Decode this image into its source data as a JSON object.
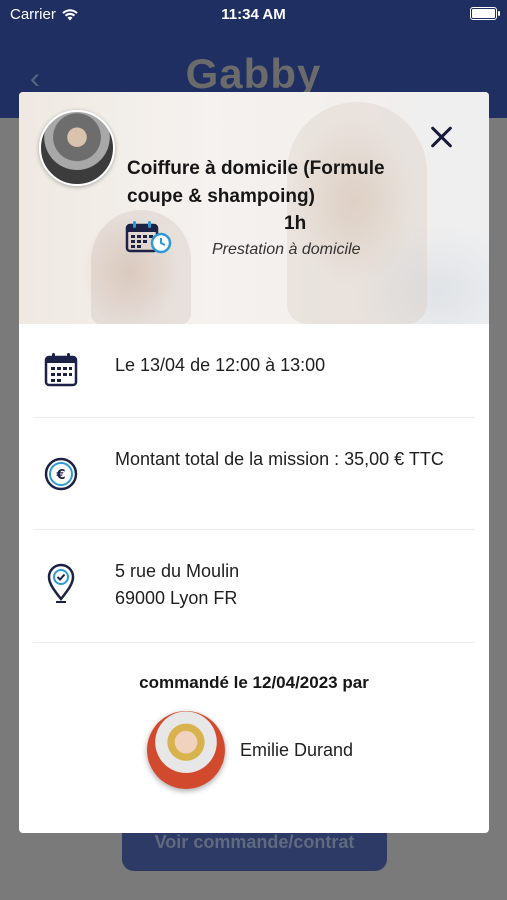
{
  "status_bar": {
    "carrier": "Carrier",
    "time": "11:34 AM"
  },
  "app": {
    "logo": "Gabby",
    "back_icon": "chevron-left-icon",
    "footer_button": "Voir commande/contrat"
  },
  "modal": {
    "service": {
      "title": "Coiffure à domicile (Formule coupe & shampoing)",
      "duration": "1h",
      "subtitle": "Prestation à domicile"
    },
    "details": {
      "date": "Le 13/04 de 12:00 à 13:00",
      "amount": "Montant total de la mission : 35,00 € TTC",
      "address_line1": "5 rue du Moulin",
      "address_line2": "69000 Lyon FR"
    },
    "ordered_by": "commandé le 12/04/2023 par",
    "client_name": "Emilie Durand"
  },
  "colors": {
    "primary_navy": "#1f2f62",
    "icon_navy": "#1c2246",
    "accent_blue": "#2d9ad8"
  }
}
